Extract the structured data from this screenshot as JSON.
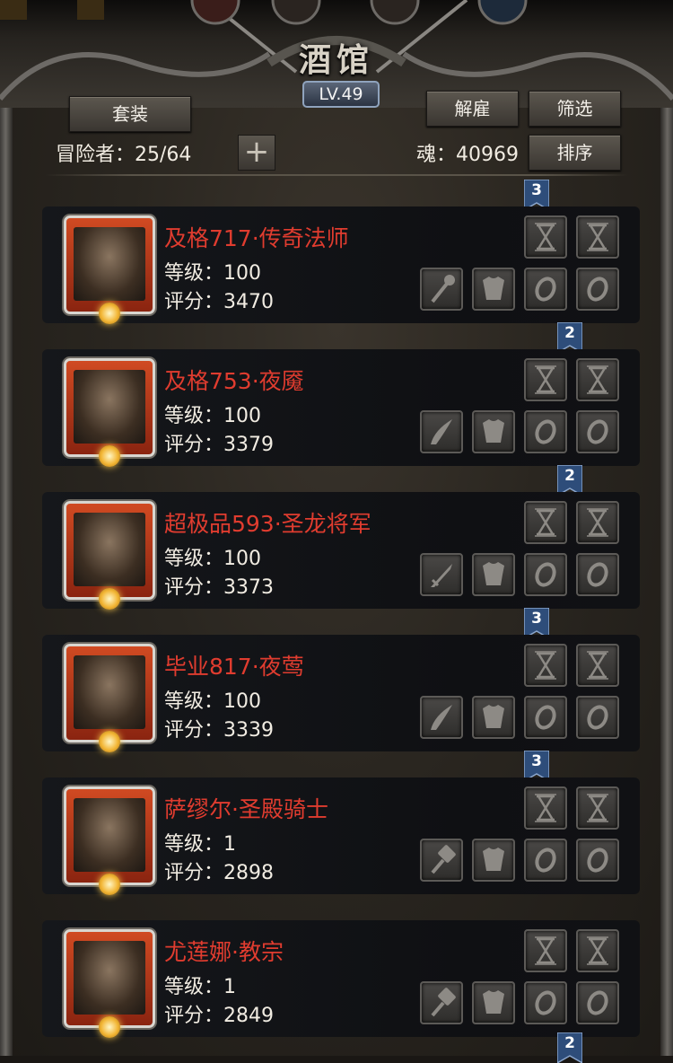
{
  "header": {
    "title": "酒馆",
    "level": "LV.49"
  },
  "toolbar": {
    "set_label": "套装",
    "dismiss_label": "解雇",
    "filter_label": "筛选",
    "sort_label": "排序",
    "add_label": "+",
    "adventurers_text": "冒险者：25/64",
    "soul_text": "魂：40969"
  },
  "heroes": [
    {
      "name": "及格717·传奇法师",
      "level": "等级：100",
      "score": "评分：3470",
      "rank_above": "3",
      "weapon": "staff"
    },
    {
      "name": "及格753·夜魇",
      "level": "等级：100",
      "score": "评分：3379",
      "rank_above": "2",
      "weapon": "blade"
    },
    {
      "name": "超极品593·圣龙将军",
      "level": "等级：100",
      "score": "评分：3373",
      "rank_above": "2",
      "weapon": "sword"
    },
    {
      "name": "毕业817·夜莺",
      "level": "等级：100",
      "score": "评分：3339",
      "rank_above": "3",
      "weapon": "blade"
    },
    {
      "name": "萨缪尔·圣殿骑士",
      "level": "等级：1",
      "score": "评分：2898",
      "rank_above": "3",
      "weapon": "hammer"
    },
    {
      "name": "尤莲娜·教宗",
      "level": "等级：1",
      "score": "评分：2849",
      "rank_above": "",
      "weapon": "hammer"
    }
  ],
  "bottom_rank": "2",
  "colors": {
    "name_red": "#e03c2f",
    "portrait_orange": "#d04a22",
    "ribbon_blue": "#2e4d7a"
  }
}
